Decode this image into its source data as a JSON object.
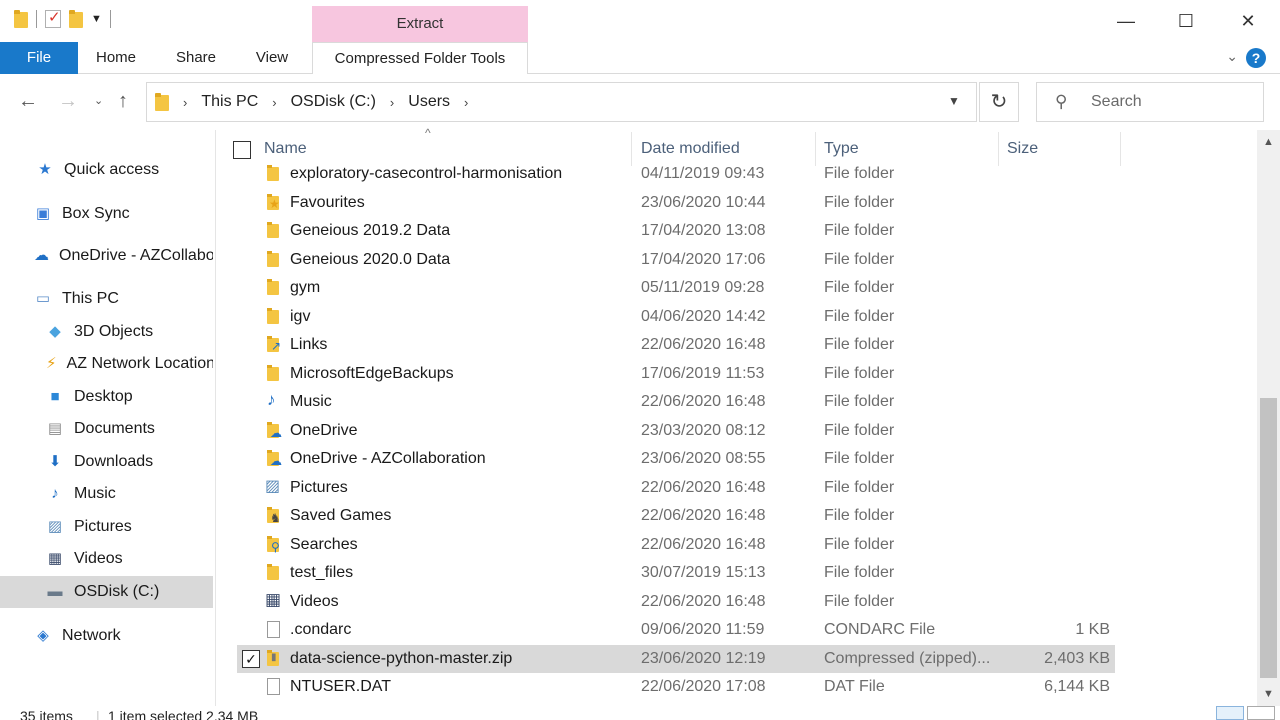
{
  "ribbon": {
    "context_group": "Extract",
    "tabs": [
      {
        "label": "File"
      },
      {
        "label": "Home"
      },
      {
        "label": "Share"
      },
      {
        "label": "View"
      },
      {
        "label": "Compressed Folder Tools"
      }
    ],
    "help": "?"
  },
  "window": {
    "minimize": "—",
    "maximize": "☐",
    "close": "✕"
  },
  "address": {
    "crumbs": [
      "This PC",
      "OSDisk (C:)",
      "Users"
    ]
  },
  "search": {
    "placeholder": "Search"
  },
  "sidebar": {
    "items": [
      {
        "label": "Quick access",
        "icon": "star-icon"
      },
      {
        "label": "Box Sync",
        "icon": "box-sync-icon"
      },
      {
        "label": "OneDrive - AZCollaboration",
        "icon": "onedrive-icon"
      },
      {
        "label": "This PC",
        "icon": "computer-icon"
      },
      {
        "label": "3D Objects",
        "icon": "3d-objects-icon"
      },
      {
        "label": "AZ Network Locations",
        "icon": "network-location-icon"
      },
      {
        "label": "Desktop",
        "icon": "desktop-icon"
      },
      {
        "label": "Documents",
        "icon": "documents-icon"
      },
      {
        "label": "Downloads",
        "icon": "downloads-icon"
      },
      {
        "label": "Music",
        "icon": "music-icon"
      },
      {
        "label": "Pictures",
        "icon": "pictures-icon"
      },
      {
        "label": "Videos",
        "icon": "videos-icon"
      },
      {
        "label": "OSDisk (C:)",
        "icon": "drive-icon"
      },
      {
        "label": "Network",
        "icon": "network-icon"
      }
    ]
  },
  "list": {
    "columns": [
      "Name",
      "Date modified",
      "Type",
      "Size"
    ],
    "rows": [
      {
        "name": "exploratory-casecontrol-harmonisation",
        "date": "04/11/2019 09:43",
        "type": "File folder",
        "size": "",
        "icon": "folder-icon"
      },
      {
        "name": "Favourites",
        "date": "23/06/2020 10:44",
        "type": "File folder",
        "size": "",
        "icon": "favourites-folder-icon"
      },
      {
        "name": "Geneious 2019.2 Data",
        "date": "17/04/2020 13:08",
        "type": "File folder",
        "size": "",
        "icon": "folder-icon"
      },
      {
        "name": "Geneious 2020.0 Data",
        "date": "17/04/2020 17:06",
        "type": "File folder",
        "size": "",
        "icon": "folder-icon"
      },
      {
        "name": "gym",
        "date": "05/11/2019 09:28",
        "type": "File folder",
        "size": "",
        "icon": "folder-icon"
      },
      {
        "name": "igv",
        "date": "04/06/2020 14:42",
        "type": "File folder",
        "size": "",
        "icon": "folder-icon"
      },
      {
        "name": "Links",
        "date": "22/06/2020 16:48",
        "type": "File folder",
        "size": "",
        "icon": "links-folder-icon"
      },
      {
        "name": "MicrosoftEdgeBackups",
        "date": "17/06/2019 11:53",
        "type": "File folder",
        "size": "",
        "icon": "folder-icon"
      },
      {
        "name": "Music",
        "date": "22/06/2020 16:48",
        "type": "File folder",
        "size": "",
        "icon": "music-icon"
      },
      {
        "name": "OneDrive",
        "date": "23/03/2020 08:12",
        "type": "File folder",
        "size": "",
        "icon": "onedrive-folder-icon"
      },
      {
        "name": "OneDrive - AZCollaboration",
        "date": "23/06/2020 08:55",
        "type": "File folder",
        "size": "",
        "icon": "onedrive-folder-icon"
      },
      {
        "name": "Pictures",
        "date": "22/06/2020 16:48",
        "type": "File folder",
        "size": "",
        "icon": "pictures-icon"
      },
      {
        "name": "Saved Games",
        "date": "22/06/2020 16:48",
        "type": "File folder",
        "size": "",
        "icon": "saved-games-icon"
      },
      {
        "name": "Searches",
        "date": "22/06/2020 16:48",
        "type": "File folder",
        "size": "",
        "icon": "searches-folder-icon"
      },
      {
        "name": "test_files",
        "date": "30/07/2019 15:13",
        "type": "File folder",
        "size": "",
        "icon": "folder-icon"
      },
      {
        "name": "Videos",
        "date": "22/06/2020 16:48",
        "type": "File folder",
        "size": "",
        "icon": "videos-icon"
      },
      {
        "name": ".condarc",
        "date": "09/06/2020 11:59",
        "type": "CONDARC File",
        "size": "1 KB",
        "icon": "file-icon"
      },
      {
        "name": "data-science-python-master.zip",
        "date": "23/06/2020 12:19",
        "type": "Compressed (zipped)...",
        "size": "2,403 KB",
        "icon": "zip-folder-icon",
        "selected": true
      },
      {
        "name": "NTUSER.DAT",
        "date": "22/06/2020 17:08",
        "type": "DAT File",
        "size": "6,144 KB",
        "icon": "file-icon"
      }
    ]
  },
  "status": {
    "count": "35 items",
    "selection": "1 item selected  2.34 MB"
  }
}
